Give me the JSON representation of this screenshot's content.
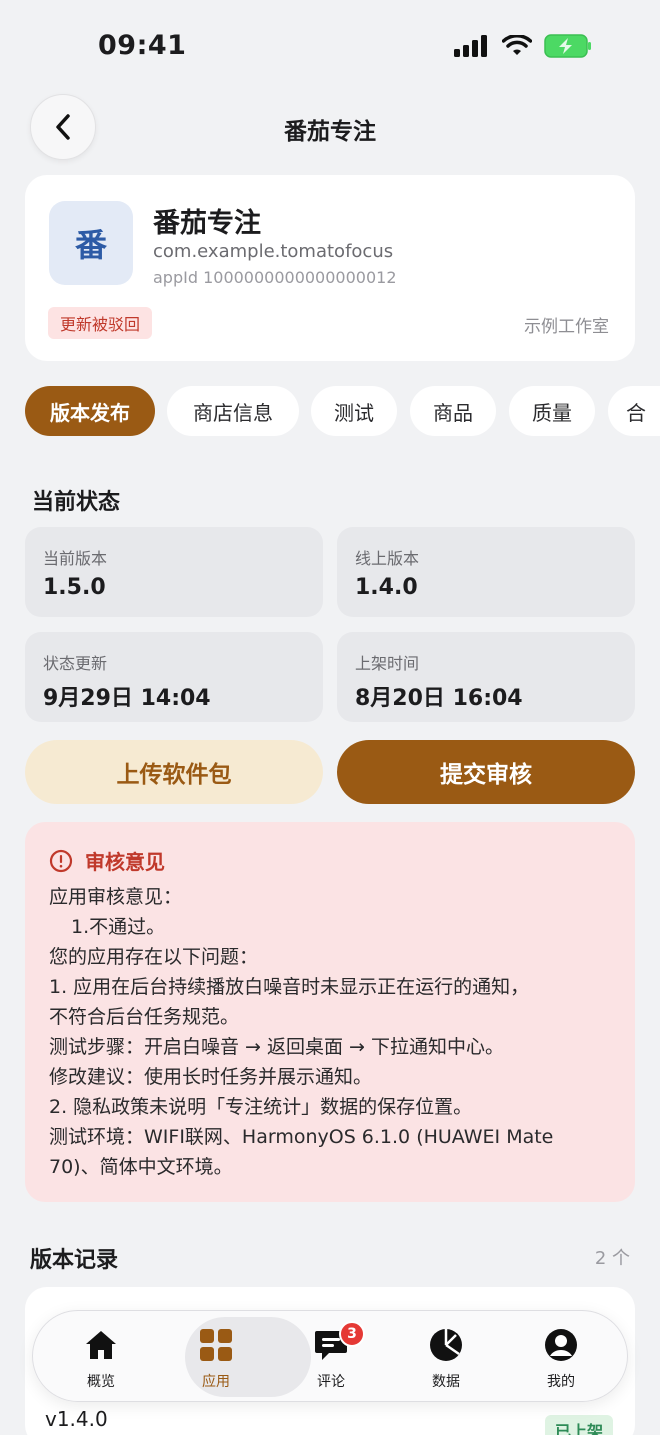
{
  "status_bar": {
    "time": "09:41"
  },
  "header": {
    "title": "番茄专注"
  },
  "app": {
    "icon_char": "番",
    "name": "番茄专注",
    "package": "com.example.tomatofocus",
    "app_id": "appId 1000000000000000012",
    "status_badge": "更新被驳回",
    "developer": "示例工作室"
  },
  "tabs": [
    {
      "label": "版本发布",
      "active": true
    },
    {
      "label": "商店信息",
      "active": false
    },
    {
      "label": "测试",
      "active": false
    },
    {
      "label": "商品",
      "active": false
    },
    {
      "label": "质量",
      "active": false
    },
    {
      "label": "合",
      "active": false
    }
  ],
  "current_status": {
    "title": "当前状态",
    "items": [
      {
        "label": "当前版本",
        "value": "1.5.0"
      },
      {
        "label": "线上版本",
        "value": "1.4.0"
      },
      {
        "label": "状态更新",
        "value": "9月29日 14:04"
      },
      {
        "label": "上架时间",
        "value": "8月20日 16:04"
      }
    ]
  },
  "actions": {
    "upload": "上传软件包",
    "submit": "提交审核"
  },
  "review": {
    "title": "审核意见",
    "lines": [
      "应用审核意见：",
      "1.不通过。",
      "您的应用存在以下问题：",
      "1. 应用在后台持续播放白噪音时未显示正在运行的通知，",
      "不符合后台任务规范。",
      "测试步骤：开启白噪音 → 返回桌面 → 下拉通知中心。",
      "修改建议：使用长时任务并展示通知。",
      "2. 隐私政策未说明「专注统计」数据的保存位置。",
      "测试环境：WIFI联网、HarmonyOS 6.1.0 (HUAWEI Mate",
      "70)、简体中文环境。"
    ]
  },
  "versions": {
    "title": "版本记录",
    "count": "2 个",
    "items": [
      {
        "version": "v1.4.0",
        "status": "已上架"
      }
    ]
  },
  "tabbar": [
    {
      "label": "概览",
      "icon": "home-icon",
      "active": false
    },
    {
      "label": "应用",
      "icon": "apps-grid-icon",
      "active": true
    },
    {
      "label": "评论",
      "icon": "comment-icon",
      "active": false,
      "badge": "3"
    },
    {
      "label": "数据",
      "icon": "pie-chart-icon",
      "active": false
    },
    {
      "label": "我的",
      "icon": "profile-icon",
      "active": false
    }
  ],
  "colors": {
    "accent": "#9a5a14",
    "accent_soft": "#f6ead2",
    "danger": "#c0392b",
    "danger_bg": "#fbe3e4",
    "success": "#2e8b57"
  }
}
